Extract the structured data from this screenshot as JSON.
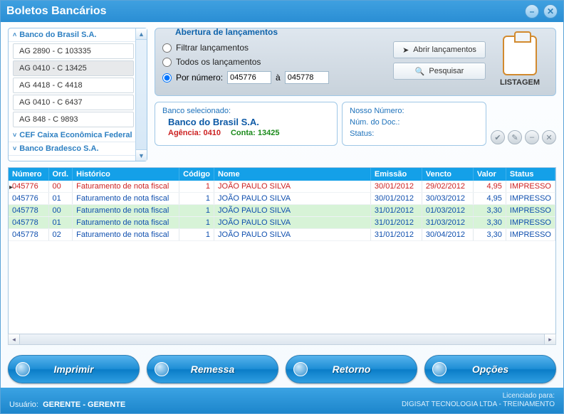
{
  "title": "Boletos Bancários",
  "banks": {
    "header1": "Banco do Brasil S.A.",
    "items": [
      "AG 2890 - C 103335",
      "AG 0410 - C 13425",
      "AG 4418 - C 4418",
      "AG 0410 - C 6437",
      "AG 848 - C 9893"
    ],
    "header2": "CEF Caixa Econômica Federal",
    "header3": "Banco Bradesco S.A."
  },
  "filter": {
    "legend": "Abertura de lançamentos",
    "opt_filtrar": "Filtrar lançamentos",
    "opt_todos": "Todos os lançamentos",
    "opt_por_numero": "Por número:",
    "num_from": "045776",
    "a": "à",
    "num_to": "045778",
    "btn_abrir": "Abrir lançamentos",
    "btn_pesquisar": "Pesquisar"
  },
  "listagem_label": "LISTAGEM",
  "selbank": {
    "label": "Banco selecionado:",
    "name": "Banco do Brasil S.A.",
    "agencia_lbl": "Agência: 0410",
    "conta_lbl": "Conta: 13425"
  },
  "nosso": {
    "nn": "Nosso Número:",
    "nd": "Núm. do Doc.:",
    "st": "Status:"
  },
  "grid": {
    "cols": {
      "numero": "Número",
      "ord": "Ord.",
      "historico": "Histórico",
      "codigo": "Código",
      "nome": "Nome",
      "emissao": "Emissão",
      "vencto": "Vencto",
      "valor": "Valor",
      "status": "Status"
    },
    "rows": [
      {
        "numero": "045776",
        "ord": "00",
        "hist": "Faturamento de nota fiscal",
        "cod": "1",
        "nome": "JOÃO PAULO SILVA",
        "emi": "30/01/2012",
        "ven": "29/02/2012",
        "val": "4,95",
        "st": "IMPRESSO",
        "cls": "r0"
      },
      {
        "numero": "045776",
        "ord": "01",
        "hist": "Faturamento de nota fiscal",
        "cod": "1",
        "nome": "JOÃO PAULO SILVA",
        "emi": "30/01/2012",
        "ven": "30/03/2012",
        "val": "4,95",
        "st": "IMPRESSO",
        "cls": "r1"
      },
      {
        "numero": "045778",
        "ord": "00",
        "hist": "Faturamento de nota fiscal",
        "cod": "1",
        "nome": "JOÃO PAULO SILVA",
        "emi": "31/01/2012",
        "ven": "01/03/2012",
        "val": "3,30",
        "st": "IMPRESSO",
        "cls": "r1 g"
      },
      {
        "numero": "045778",
        "ord": "01",
        "hist": "Faturamento de nota fiscal",
        "cod": "1",
        "nome": "JOÃO PAULO SILVA",
        "emi": "31/01/2012",
        "ven": "31/03/2012",
        "val": "3,30",
        "st": "IMPRESSO",
        "cls": "r1 g"
      },
      {
        "numero": "045778",
        "ord": "02",
        "hist": "Faturamento de nota fiscal",
        "cod": "1",
        "nome": "JOÃO PAULO SILVA",
        "emi": "31/01/2012",
        "ven": "30/04/2012",
        "val": "3,30",
        "st": "IMPRESSO",
        "cls": "r1"
      }
    ]
  },
  "buttons": {
    "imprimir": "Imprimir",
    "remessa": "Remessa",
    "retorno": "Retorno",
    "opcoes": "Opções"
  },
  "status": {
    "usuario_lbl": "Usuário:",
    "usuario": "GERENTE - GERENTE",
    "lic_lbl": "Licenciado para:",
    "company": "DIGISAT TECNOLOGIA LTDA - TREINAMENTO"
  }
}
